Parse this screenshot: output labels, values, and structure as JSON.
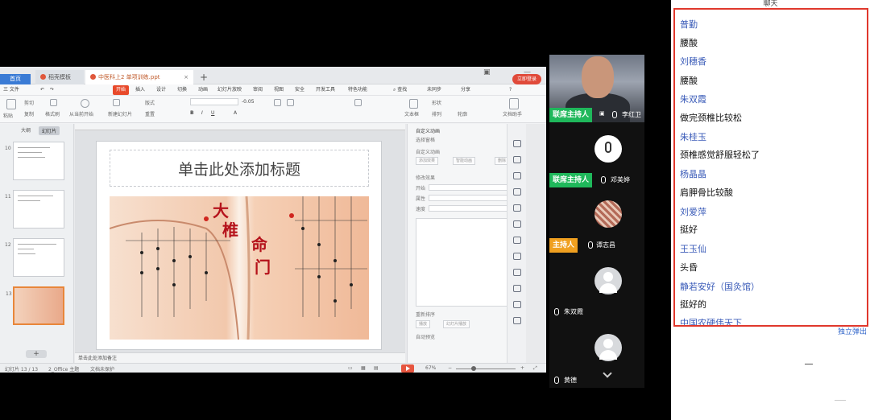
{
  "wps": {
    "tabs": [
      {
        "label": "首页"
      },
      {
        "label": "稻壳模板"
      },
      {
        "label": "中医科上2 单项训练.ppt"
      }
    ],
    "login": "立即登录",
    "menu": [
      "三 文件",
      "开始",
      "插入",
      "设计",
      "切换",
      "动画",
      "幻灯片放映",
      "审阅",
      "视图",
      "安全",
      "开发工具",
      "特色功能",
      "查找",
      "未同步",
      "分享"
    ],
    "ribbon": {
      "paste": "粘贴",
      "cut": "剪切",
      "copy": "复制",
      "format": "格式刷",
      "play_from": "从当前开始",
      "new_slide": "新建幻灯片",
      "layout": "版式",
      "reset": "重置",
      "font_size": "-0.05",
      "textbox": "文本框",
      "shape": "形状",
      "arrange": "排列",
      "outline": "轮廓",
      "help": "文档助手"
    },
    "thumbs": {
      "tabs": [
        "大纲",
        "幻灯片"
      ],
      "nums": [
        "10",
        "11",
        "12",
        "13"
      ]
    },
    "slide": {
      "title": "单击此处添加标题",
      "char1": "大",
      "char2": "椎",
      "char3": "命",
      "char4": "门"
    },
    "notes": "单击此处添加备注",
    "anim_panel": {
      "title": "自定义动画",
      "select_pane": "选择窗格",
      "add_label": "自定义动画",
      "add_effect": "添加效果",
      "smart": "智能动画",
      "delete": "删除",
      "modify": "修改效果",
      "start": "开始",
      "property": "属性",
      "speed": "速度",
      "reorder": "重新排序",
      "play": "播放",
      "slideshow": "幻灯片播放",
      "autopreview": "自动预览"
    },
    "status": {
      "slide": "幻灯片 13 / 13",
      "theme": "2_Office 主题",
      "docs": "文档未保护",
      "zoom": "67%"
    }
  },
  "video": [
    {
      "role": "联席主持人",
      "name": "李红卫",
      "mic": "on"
    },
    {
      "role": "联席主持人",
      "name": "邓美婷",
      "mic": "on"
    },
    {
      "role": "主持人",
      "name": "谭志昌",
      "mic": "on"
    },
    {
      "role": "",
      "name": "朱双霞",
      "mic": "on"
    },
    {
      "role": "",
      "name": "黄德",
      "mic": "on"
    }
  ],
  "chat": {
    "title": "聊天",
    "messages": [
      {
        "user": "普勤",
        "text": "腰酸"
      },
      {
        "user": "刘穗香",
        "text": "腰酸"
      },
      {
        "user": "朱双霞",
        "text": "做完颈椎比较松"
      },
      {
        "user": "朱桂玉",
        "text": "颈椎感觉舒服轻松了"
      },
      {
        "user": "杨晶晶",
        "text": "肩胛骨比较酸"
      },
      {
        "user": "刘爱萍",
        "text": "挺好"
      },
      {
        "user": "王玉仙",
        "text": "头昏"
      },
      {
        "user": "静若安好（国灸馆）",
        "text": "挺好的"
      },
      {
        "user": "中国农硬伟天下",
        "text": ""
      }
    ],
    "detach": "独立弹出",
    "accent": "#e0382c"
  }
}
